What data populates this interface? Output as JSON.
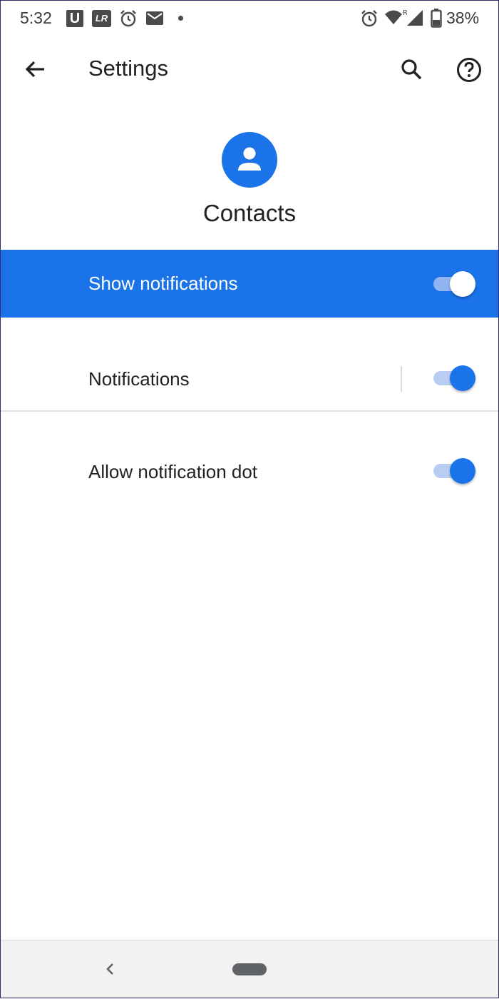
{
  "status_bar": {
    "time": "5:32",
    "notif_u": "U",
    "notif_lr": "LR",
    "battery": "38%",
    "icons": [
      "u-app-icon",
      "lr-app-icon",
      "alarm-icon",
      "mail-icon",
      "dot-icon",
      "alarm-icon",
      "wifi-icon",
      "signal-icon",
      "battery-icon"
    ]
  },
  "app_bar": {
    "title": "Settings",
    "icons": [
      "arrow-back-icon",
      "search-icon",
      "help-icon"
    ]
  },
  "app": {
    "name": "Contacts",
    "icon": "person-icon",
    "icon_color": "#1a73e8"
  },
  "rows": {
    "show_notifications": {
      "label": "Show notifications",
      "enabled": true
    },
    "notifications": {
      "label": "Notifications",
      "enabled": true
    },
    "notification_dot": {
      "label": "Allow notification dot",
      "enabled": true
    }
  },
  "colors": {
    "accent": "#1a73e8",
    "text": "#202124"
  },
  "nav_bar": {
    "icons": [
      "nav-back-icon",
      "home-pill-icon"
    ]
  }
}
